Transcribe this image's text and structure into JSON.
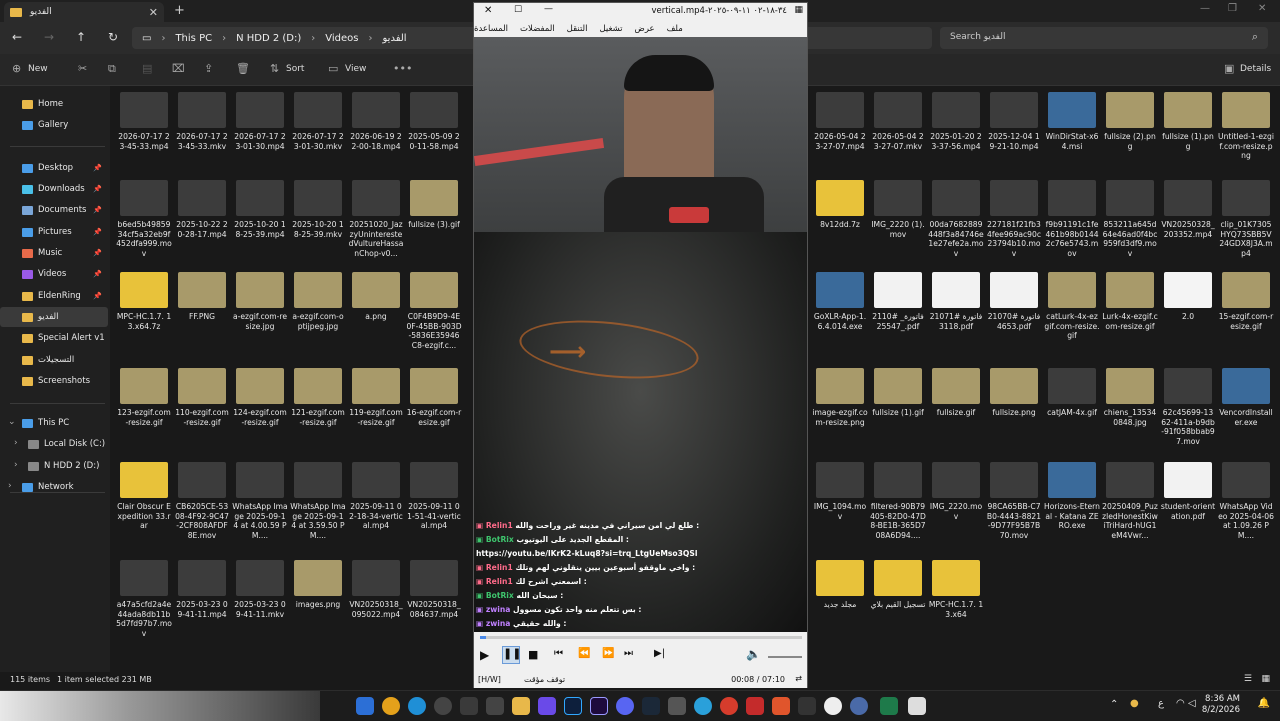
{
  "explorer": {
    "tab_title": "الفديو",
    "breadcrumbs": [
      "This PC",
      "N HDD 2 (D:)",
      "Videos",
      "الفديو"
    ],
    "search_placeholder": "Search الفديو",
    "toolbar": {
      "new": "New",
      "sort": "Sort",
      "view": "View",
      "details": "Details"
    },
    "sidebar": [
      {
        "label": "Home",
        "color": "#e8b84a"
      },
      {
        "label": "Gallery",
        "color": "#4a9de8"
      },
      {
        "label": "Desktop",
        "color": "#4a9de8",
        "pinned": true
      },
      {
        "label": "Downloads",
        "color": "#4ac0e8",
        "pinned": true
      },
      {
        "label": "Documents",
        "color": "#7aa6d8",
        "pinned": true
      },
      {
        "label": "Pictures",
        "color": "#4a9de8",
        "pinned": true
      },
      {
        "label": "Music",
        "color": "#e86a4a",
        "pinned": true
      },
      {
        "label": "Videos",
        "color": "#9a5ae8",
        "pinned": true
      },
      {
        "label": "EldenRing",
        "color": "#e8b84a",
        "pinned": true
      },
      {
        "label": "الفديو",
        "color": "#e8b84a",
        "selected": true
      },
      {
        "label": "Special Alert v1",
        "color": "#e8b84a"
      },
      {
        "label": "التسجيلات",
        "color": "#e8b84a"
      },
      {
        "label": "Screenshots",
        "color": "#e8b84a"
      },
      {
        "label": "This PC",
        "color": "#4a9de8"
      },
      {
        "label": "Local Disk (C:)",
        "color": "#888888"
      },
      {
        "label": "N HDD 2 (D:)",
        "color": "#888888"
      },
      {
        "label": "Network",
        "color": "#4a9de8"
      }
    ],
    "files_left": [
      [
        "2026-07-17 23-45-33.mp4",
        "2026-07-17 23-45-33.mkv",
        "2026-07-17 23-01-30.mp4",
        "2026-07-17 23-01-30.mkv",
        "2026-06-19 22-00-18.mp4",
        "2025-05-09 20-11-58.mp4"
      ],
      [
        "b6ed5b49859 34cf5a32eb9f 452dfa999.mov",
        "2025-10-22 20-28-17.mp4",
        "2025-10-20 18-25-39.mp4",
        "2025-10-20 18-25-39.mkv",
        "20251020_JazzyUninterestedVultureHassanChop-v0...",
        "fullsize (3).gif"
      ],
      [
        "MPC-HC.1.7. 13.x64.7z",
        "FF.PNG",
        "a-ezgif.com-resize.jpg",
        "a-ezgif.com-optijpeg.jpg",
        "a.png",
        "C0F4B9D9-4E0F-45BB-903D-5836E35946C8-ezgif.c..."
      ],
      [
        "123-ezgif.com-resize.gif",
        "110-ezgif.com-resize.gif",
        "124-ezgif.com-resize.gif",
        "121-ezgif.com-resize.gif",
        "119-ezgif.com-resize.gif",
        "16-ezgif.com-resize.gif"
      ],
      [
        "Clair Obscur Expedition 33.rar",
        "CB6205CE-5308-4F92-9C47-2CF808AFDF8E.mov",
        "WhatsApp Image 2025-09-14 at 4.00.59 PM....",
        "WhatsApp Image 2025-09-14 at 3.59.50 PM....",
        "2025-09-11 02-18-34-vertical.mp4",
        "2025-09-11 01-51-41-vertical.mp4"
      ],
      [
        "a47a5cfd2a4e 44ada8db11b 5d7fd97b7.mov",
        "2025-03-23 09-41-11.mp4",
        "2025-03-23 09-41-11.mkv",
        "images.png",
        "VN20250318_095022.mp4",
        "VN20250318_084637.mp4"
      ]
    ],
    "files_right": [
      [
        "2026-05-04 23-27-07.mp4",
        "2026-05-04 23-27-07.mkv",
        "2025-01-20 23-37-56.mp4",
        "2025-12-04 19-21-10.mp4",
        "WinDirStat-x64.msi",
        "fullsize (2).png",
        "fullsize (1).png",
        "Untitled-1-ezgif.com-resize.png"
      ],
      [
        "8v12dd.7z",
        "IMG_2220 (1).mov",
        "00da7682889 448f3a84746e 1e27efe2a.mov",
        "227181f21fb3 4fee969ac90c 23794b10.mov",
        "f9b91191c1fe 461b98b0144 2c76e5743.mov",
        "853211a645d 64e46ad0f4bc 959fd3df9.mov",
        "VN20250328_203352.mp4",
        "clip_01K7305HYQ73SBB5V24GDX8J3A.mp4"
      ],
      [
        "GoXLR-App-1.6.4.014.exe",
        "فاتورة_ #211025547_.pdf",
        "فاتورة #210713118.pdf",
        "فاتورة #210704653.pdf",
        "catLurk-4x-ezgif.com-resize.gif",
        "Lurk-4x-ezgif.com-resize.gif",
        "2.0",
        "15-ezgif.com-resize.gif"
      ],
      [
        "image-ezgif.com-resize.png",
        "fullsize (1).gif",
        "fullsize.gif",
        "fullsize.png",
        "catJAM-4x.gif",
        "chiens_13534 0848.jpg",
        "62c45699-13 62-411a-b9db-91f058bbab97.mov",
        "VencordInstaller.exe"
      ],
      [
        "IMG_1094.mov",
        "filtered-90B79405-82D0-47D8-BE1B-365D708A6D94....",
        "IMG_2220.mov",
        "98CA65BB-C7B0-4443-8821-9D77F95B7B70.mov",
        "Horizons-Eternal - Katana ZERO.exe",
        "20250409_PuzzledHonestKiwiTriHard-hUG1eM4Vwr...",
        "student-orientation.pdf",
        "WhatsApp Video 2025-04-06 at 1.09.26 PM...."
      ],
      [
        "مجلد جديد",
        "تسجيل القيم بلاي",
        "MPC-HC.1.7. 13.x64"
      ]
    ],
    "status": {
      "items": "115 items",
      "selected": "1 item selected  231 MB"
    }
  },
  "player": {
    "title": "vertical.mp4-٣٤-١٨-٠٢ ١١-٠٩-٢٠٢٥",
    "menu": [
      "ملف",
      "عرض",
      "تشغيل",
      "التنقل",
      "المفضلات",
      "المساعدة"
    ],
    "chat": [
      {
        "user": "Relin1",
        "text": "طلع لي امن سيراني في مدينه غير وراحت والله :",
        "color": "#ff6b8a"
      },
      {
        "user": "BotRix",
        "text": "المقطع الجديد على اليوتيوب :",
        "color": "#3ec46d"
      },
      {
        "user": "",
        "text": "https://youtu.be/lKrK2-kLuq8?si=trq_LtgUeMso3QSl",
        "color": "#ffffff"
      },
      {
        "user": "Relin1",
        "text": "واخي ماوقفو أسبوعين بيين ينقلوني لهم وتلك :",
        "color": "#ff6b8a"
      },
      {
        "user": "Relin1",
        "text": "اسمعني اشرح لك :",
        "color": "#ff6b8a"
      },
      {
        "user": "BotRix",
        "text": "سبحان الله :",
        "color": "#3ec46d"
      },
      {
        "user": "zwina",
        "text": "بس تتعلم منه واحد تكون مسوول :",
        "color": "#c080ff"
      },
      {
        "user": "zwina",
        "text": "والله حقيقي :",
        "color": "#c080ff"
      }
    ],
    "status_left": "[H/W]",
    "status_mid": "توقف مؤقت",
    "time": "00:08 / 07:10",
    "progress": 0.02
  },
  "taskbar": {
    "time": "8:36 AM",
    "date": "8/2/2026",
    "lang": "ع"
  }
}
